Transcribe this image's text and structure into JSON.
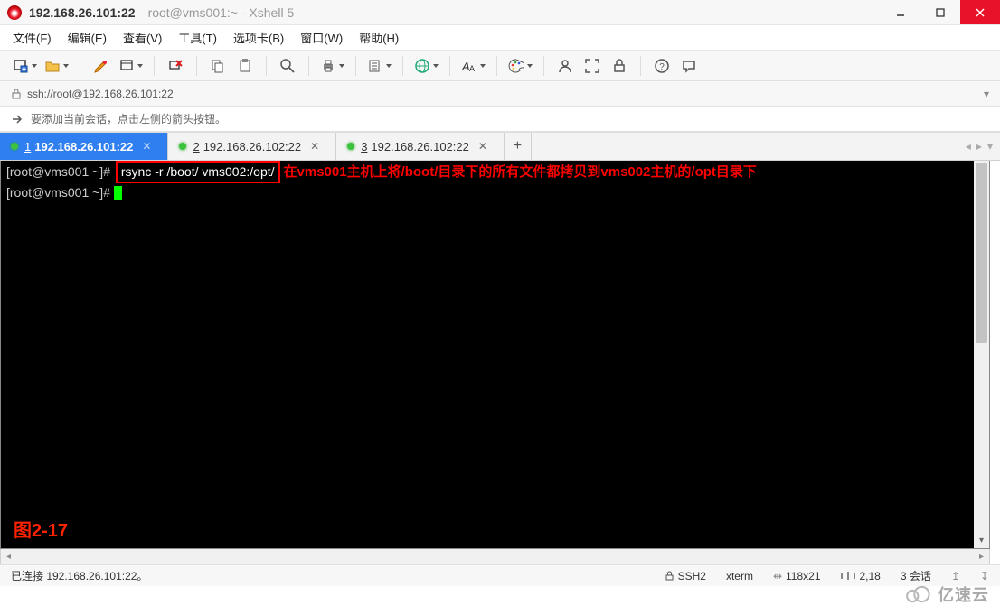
{
  "title": {
    "host": "192.168.26.101:22",
    "suffix": "root@vms001:~ - Xshell 5"
  },
  "menu": {
    "file": "文件(F)",
    "edit": "编辑(E)",
    "view": "查看(V)",
    "tools": "工具(T)",
    "tabs": "选项卡(B)",
    "window": "窗口(W)",
    "help": "帮助(H)"
  },
  "address": {
    "url": "ssh://root@192.168.26.101:22"
  },
  "hint": {
    "text": "要添加当前会话，点击左侧的箭头按钮。"
  },
  "session_tabs": [
    {
      "num": "1",
      "label": "192.168.26.101:22",
      "active": true
    },
    {
      "num": "2",
      "label": "192.168.26.102:22",
      "active": false
    },
    {
      "num": "3",
      "label": "192.168.26.102:22",
      "active": false
    }
  ],
  "add_tab": "+",
  "terminal": {
    "prompt1": "[root@vms001 ~]#",
    "cmd1": "rsync -r /boot/ vms002:/opt/",
    "annotation": "在vms001主机上将/boot/目录下的所有文件都拷贝到vms002主机的/opt目录下",
    "prompt2": "[root@vms001 ~]# ",
    "figure": "图2-17"
  },
  "status": {
    "conn": "已连接 192.168.26.101:22。",
    "proto": "SSH2",
    "term": "xterm",
    "size": "118x21",
    "pos": "2,18",
    "sessions": "3 会话"
  },
  "watermark": "亿速云"
}
